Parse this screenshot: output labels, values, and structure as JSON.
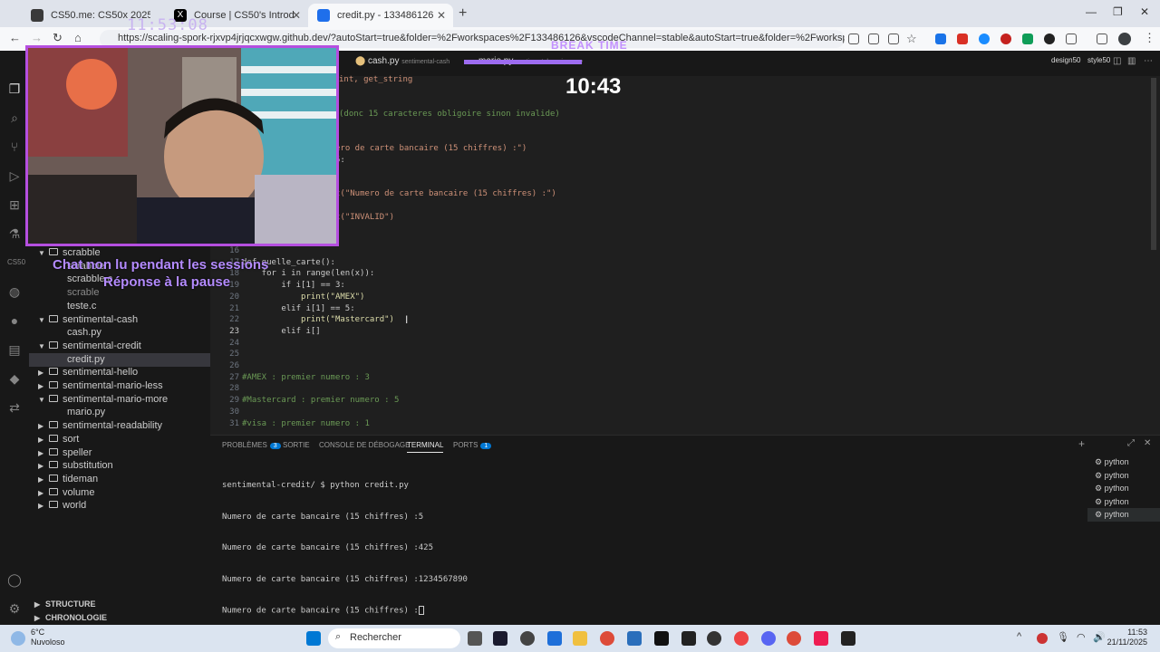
{
  "browser": {
    "tabs": [
      {
        "title": "CS50.me: CS50x 2025",
        "color": "#3a3a3a"
      },
      {
        "title": "Course | CS50's Introduction to",
        "color": "#000000"
      },
      {
        "title": "credit.py - 133486126 [Codesp",
        "color": "#1f6feb"
      }
    ],
    "url": "https://scaling-spork-rjxvp4jrjqcxwgw.github.dev/?autoStart=true&folder=%2Fworkspaces%2F133486126&vscodeChannel=stable&autoStart=true&folder=%2Fworkspaces%2F133486126&vs..."
  },
  "overlay": {
    "clock": "11:53:08",
    "break_label": "BREAK TIME",
    "timer": "10:43",
    "chat_line1": "Chat non lu pendant les sessions",
    "chat_line2": "Réponse à la pause"
  },
  "editor": {
    "tabs": [
      {
        "name": "cash.py",
        "path": "sentimental-cash"
      },
      {
        "name": "mario.py",
        "path": "sentimental-mario-more"
      }
    ],
    "right_tabs": [
      "design50",
      "style50"
    ]
  },
  "code_fragments": [
    {
      "text": "int, get_string",
      "cls": "p"
    },
    {
      "text": "(donc 15 caracteres obligoire sinon invalide)",
      "cls": "c"
    },
    {
      "text": "ero de carte bancaire (15 chiffres) :\")",
      "cls": "s"
    },
    {
      "text": "5:",
      "cls": "p"
    },
    {
      "text": "t(\"Numero de carte bancaire (15 chiffres) :\")",
      "cls": "s"
    },
    {
      "text": "t(\"INVALID\")",
      "cls": "s"
    }
  ],
  "code_lines": [
    {
      "ln": "16",
      "text": ""
    },
    {
      "ln": "17",
      "text": "def quelle_carte():"
    },
    {
      "ln": "18",
      "text": "    for i in range(len(x)):"
    },
    {
      "ln": "19",
      "text": "        if i[1] == 3:"
    },
    {
      "ln": "20",
      "text": "            print(\"AMEX\")"
    },
    {
      "ln": "21",
      "text": "        elif i[1] == 5:"
    },
    {
      "ln": "22",
      "text": "            print(\"Mastercard\")"
    },
    {
      "ln": "23",
      "text": "        elif i[]"
    },
    {
      "ln": "24",
      "text": ""
    },
    {
      "ln": "25",
      "text": ""
    },
    {
      "ln": "26",
      "text": ""
    },
    {
      "ln": "27",
      "text": "#AMEX : premier numero : 3"
    },
    {
      "ln": "28",
      "text": ""
    },
    {
      "ln": "29",
      "text": "#Mastercard : premier numero : 5"
    },
    {
      "ln": "30",
      "text": ""
    },
    {
      "ln": "31",
      "text": "#visa : premier numero : 1"
    }
  ],
  "explorer": [
    {
      "label": "scrabble",
      "type": "folder-open",
      "indent": 0
    },
    {
      "label": "scrabble",
      "type": "file",
      "indent": 1
    },
    {
      "label": "scrabble.c",
      "type": "file",
      "indent": 1
    },
    {
      "label": "scrable",
      "type": "file-dim",
      "indent": 1
    },
    {
      "label": "teste.c",
      "type": "file",
      "indent": 1
    },
    {
      "label": "sentimental-cash",
      "type": "folder-open",
      "indent": 0
    },
    {
      "label": "cash.py",
      "type": "file",
      "indent": 1
    },
    {
      "label": "sentimental-credit",
      "type": "folder-open",
      "indent": 0
    },
    {
      "label": "credit.py",
      "type": "file-selected",
      "indent": 1
    },
    {
      "label": "sentimental-hello",
      "type": "folder",
      "indent": 0
    },
    {
      "label": "sentimental-mario-less",
      "type": "folder",
      "indent": 0
    },
    {
      "label": "sentimental-mario-more",
      "type": "folder-open",
      "indent": 0
    },
    {
      "label": "mario.py",
      "type": "file",
      "indent": 1
    },
    {
      "label": "sentimental-readability",
      "type": "folder",
      "indent": 0
    },
    {
      "label": "sort",
      "type": "folder",
      "indent": 0
    },
    {
      "label": "speller",
      "type": "folder",
      "indent": 0
    },
    {
      "label": "substitution",
      "type": "folder",
      "indent": 0
    },
    {
      "label": "tideman",
      "type": "folder",
      "indent": 0
    },
    {
      "label": "volume",
      "type": "folder",
      "indent": 0
    },
    {
      "label": "world",
      "type": "folder",
      "indent": 0
    }
  ],
  "sidebar_footer": [
    "STRUCTURE",
    "CHRONOLOGIE"
  ],
  "activity_label": "CS50",
  "panel": {
    "tabs": [
      {
        "label": "PROBLÈMES",
        "badge": "3"
      },
      {
        "label": "SORTIE",
        "badge": ""
      },
      {
        "label": "CONSOLE DE DÉBOGAGE",
        "badge": ""
      },
      {
        "label": "TERMINAL",
        "badge": ""
      },
      {
        "label": "PORTS",
        "badge": "1"
      }
    ],
    "terminal_lines": [
      "sentimental-credit/ $ python credit.py",
      "Numero de carte bancaire (15 chiffres) :5",
      "Numero de carte bancaire (15 chiffres) :425",
      "Numero de carte bancaire (15 chiffres) :1234567890",
      "Numero de carte bancaire (15 chiffres) :"
    ],
    "terminal_list": [
      "python",
      "python",
      "python",
      "python",
      "python"
    ]
  },
  "taskbar": {
    "weather_temp": "6°C",
    "weather_desc": "Nuvoloso",
    "search_placeholder": "Rechercher",
    "time": "11:53",
    "date": "21/11/2025"
  }
}
